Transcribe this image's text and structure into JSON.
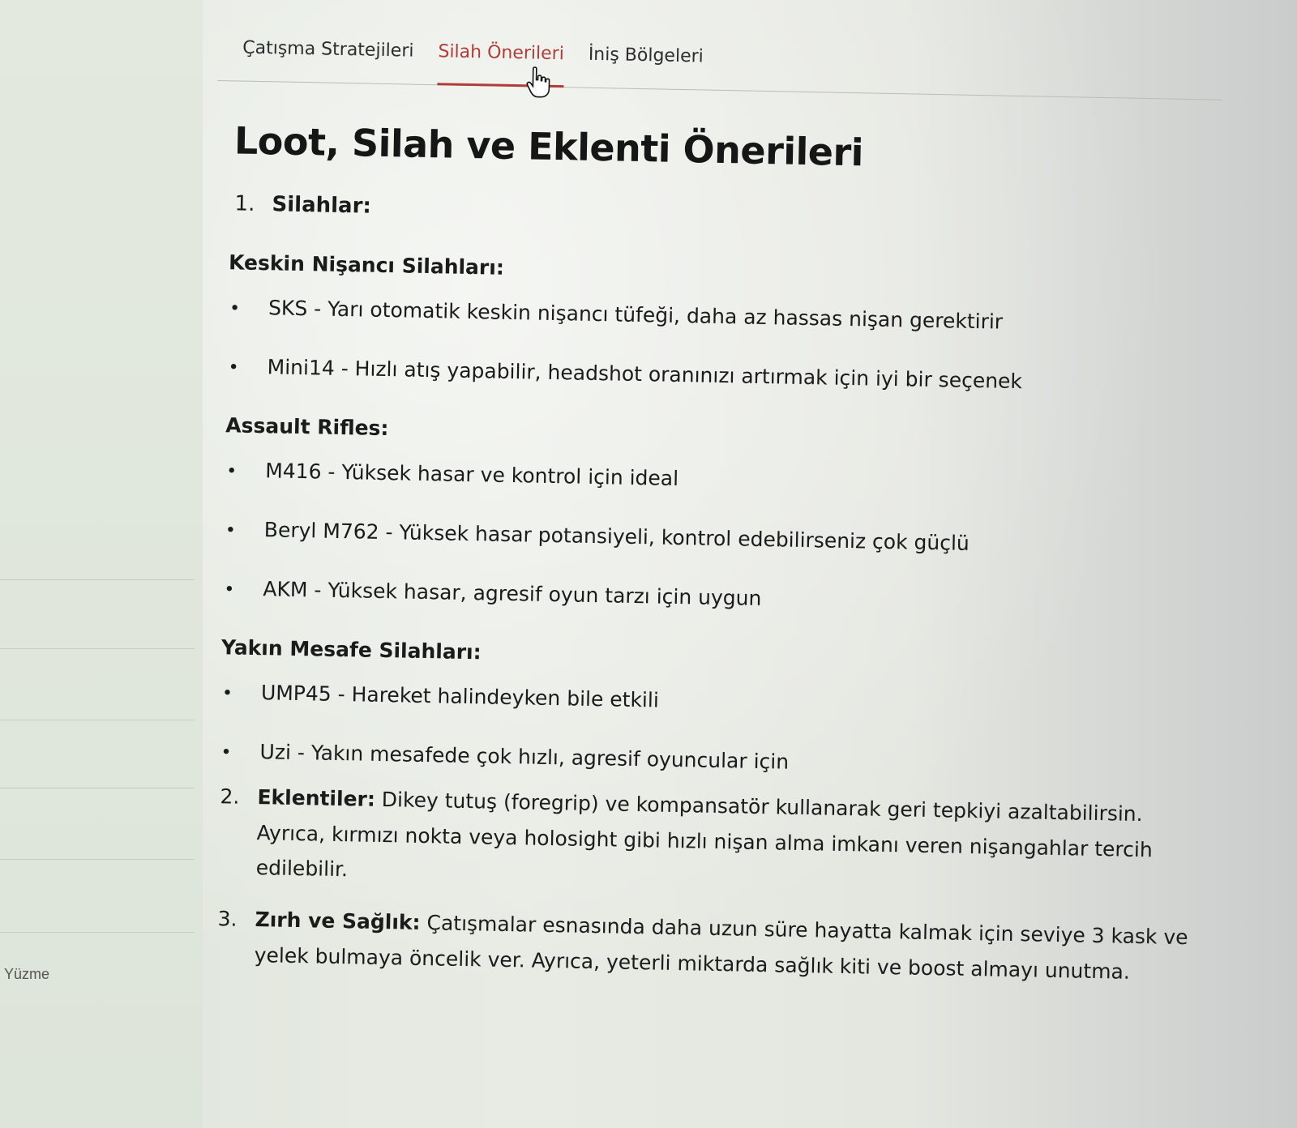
{
  "sidebar": {
    "item_label": "Yüzme"
  },
  "tabs": [
    {
      "label": "Çatışma Stratejileri",
      "active": false
    },
    {
      "label": "Silah Önerileri",
      "active": true
    },
    {
      "label": "İniş Bölgeleri",
      "active": false
    }
  ],
  "colors": {
    "accent": "#b23c3a"
  },
  "page": {
    "title": "Loot, Silah ve Eklenti Önerileri"
  },
  "sections": {
    "weapons": {
      "number": "1.",
      "label": "Silahlar:",
      "groups": [
        {
          "heading": "Keskin Nişancı Silahları:",
          "items": [
            "SKS - Yarı otomatik keskin nişancı tüfeği, daha az hassas nişan gerektirir",
            "Mini14 - Hızlı atış yapabilir, headshot oranınızı artırmak için iyi bir seçenek"
          ]
        },
        {
          "heading": "Assault Rifles:",
          "items": [
            "M416 - Yüksek hasar ve kontrol için ideal",
            "Beryl M762 - Yüksek hasar potansiyeli, kontrol edebilirseniz çok güçlü",
            "AKM - Yüksek hasar, agresif oyun tarzı için uygun"
          ]
        },
        {
          "heading": "Yakın Mesafe Silahları:",
          "items": [
            "UMP45 - Hareket halindeyken bile etkili",
            "Uzi - Yakın mesafede çok hızlı, agresif oyuncular için"
          ]
        }
      ]
    },
    "attachments": {
      "number": "2.",
      "label": "Eklentiler:",
      "text": "Dikey tutuş (foregrip) ve kompansatör kullanarak geri tepkiyi azaltabilirsin. Ayrıca, kırmızı nokta veya holosight gibi hızlı nişan alma imkanı veren nişangahlar tercih edilebilir."
    },
    "armor": {
      "number": "3.",
      "label": "Zırh ve Sağlık:",
      "text": "Çatışmalar esnasında daha uzun süre hayatta kalmak için seviye 3 kask ve yelek bulmaya öncelik ver. Ayrıca, yeterli miktarda sağlık kiti ve boost almayı unutma."
    }
  },
  "bullet_glyph": "•",
  "icons": {
    "cursor": "hand-pointer-icon"
  }
}
